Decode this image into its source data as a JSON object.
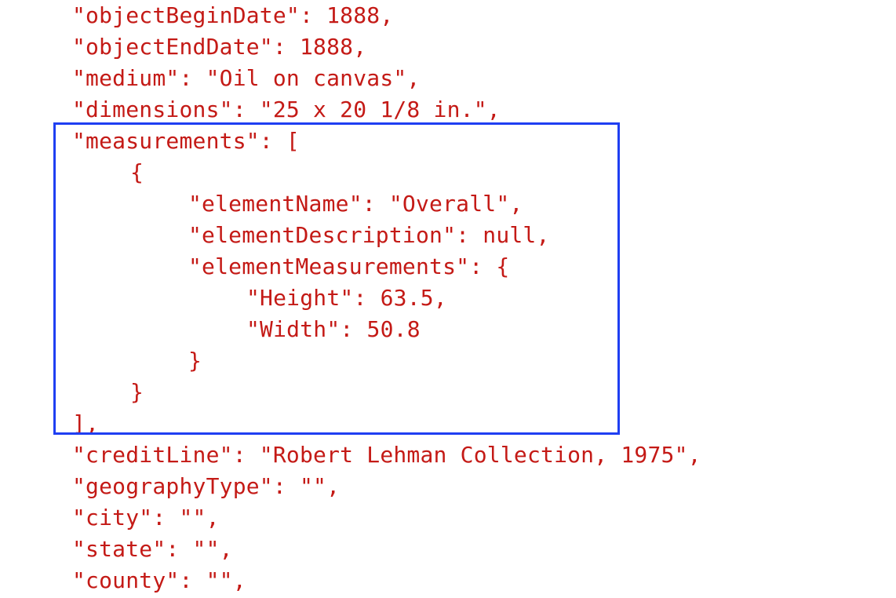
{
  "code": {
    "lines": [
      {
        "indent": 0,
        "text": "\"objectBeginDate\": 1888,"
      },
      {
        "indent": 0,
        "text": "\"objectEndDate\": 1888,"
      },
      {
        "indent": 0,
        "text": "\"medium\": \"Oil on canvas\","
      },
      {
        "indent": 0,
        "text": "\"dimensions\": \"25 x 20 1/8 in.\","
      },
      {
        "indent": 0,
        "text": "\"measurements\": ["
      },
      {
        "indent": 1,
        "text": "{"
      },
      {
        "indent": 2,
        "text": "\"elementName\": \"Overall\","
      },
      {
        "indent": 2,
        "text": "\"elementDescription\": null,"
      },
      {
        "indent": 2,
        "text": "\"elementMeasurements\": {"
      },
      {
        "indent": 3,
        "text": "\"Height\": 63.5,"
      },
      {
        "indent": 3,
        "text": "\"Width\": 50.8"
      },
      {
        "indent": 2,
        "text": "}"
      },
      {
        "indent": 1,
        "text": "}"
      },
      {
        "indent": 0,
        "text": "],"
      },
      {
        "indent": 0,
        "text": "\"creditLine\": \"Robert Lehman Collection, 1975\","
      },
      {
        "indent": 0,
        "text": "\"geographyType\": \"\","
      },
      {
        "indent": 0,
        "text": "\"city\": \"\","
      },
      {
        "indent": 0,
        "text": "\"state\": \"\","
      },
      {
        "indent": 0,
        "text": "\"county\": \"\","
      }
    ]
  },
  "colors": {
    "code_text": "#c41a16",
    "highlight_border": "#1f3ff2",
    "background": "#ffffff"
  }
}
